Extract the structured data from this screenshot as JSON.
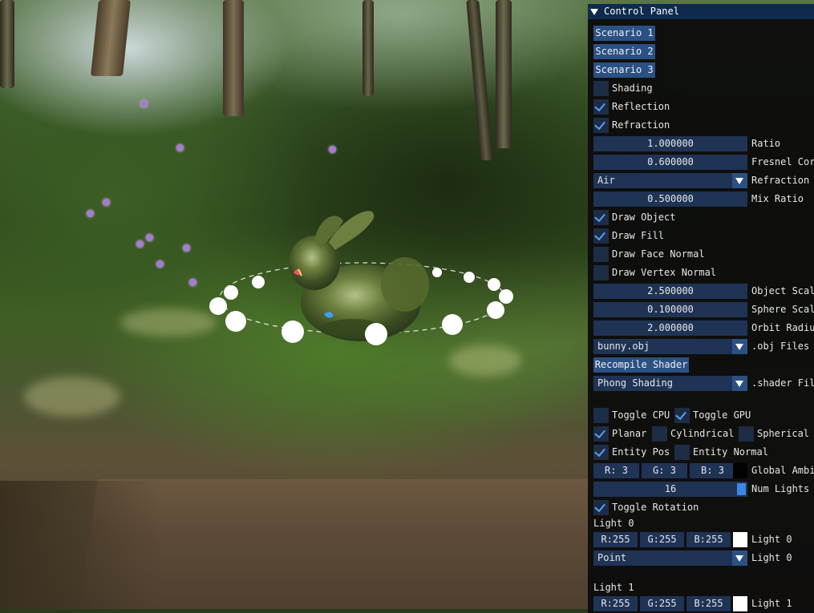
{
  "panel": {
    "title": "Control Panel",
    "scenario_buttons": [
      "Scenario 1",
      "Scenario 2",
      "Scenario 3"
    ],
    "checks_top": [
      {
        "label": "Shading",
        "checked": false
      },
      {
        "label": "Reflection",
        "checked": true
      },
      {
        "label": "Refraction",
        "checked": true
      }
    ],
    "ratio": {
      "value": "1.000000",
      "label": "Ratio"
    },
    "fresnel": {
      "value": "0.600000",
      "label": "Fresnel Cor"
    },
    "refraction_combo": {
      "value": "Air",
      "label": "Refraction"
    },
    "mix_ratio": {
      "value": "0.500000",
      "label": "Mix Ratio"
    },
    "draw_checks": [
      {
        "label": "Draw Object",
        "checked": true
      },
      {
        "label": "Draw Fill",
        "checked": true
      },
      {
        "label": "Draw Face Normal",
        "checked": false
      },
      {
        "label": "Draw Vertex Normal",
        "checked": false
      }
    ],
    "object_scale": {
      "value": "2.500000",
      "label": "Object Scal"
    },
    "sphere_scale": {
      "value": "0.100000",
      "label": "Sphere Scal"
    },
    "orbit_radius": {
      "value": "2.000000",
      "label": "Orbit Radiu"
    },
    "obj_file": {
      "value": "bunny.obj",
      "label": ".obj Files"
    },
    "recompile_label": "Recompile Shader",
    "shader_file": {
      "value": "Phong Shading",
      "label": ".shader Fil"
    },
    "toggle_cpu": {
      "label": "Toggle CPU",
      "checked": false
    },
    "toggle_gpu": {
      "label": "Toggle GPU",
      "checked": true
    },
    "planar": {
      "label": "Planar",
      "checked": true
    },
    "cylindrical": {
      "label": "Cylindrical",
      "checked": false
    },
    "spherical": {
      "label": "Spherical",
      "checked": false
    },
    "entity_pos": {
      "label": "Entity Pos",
      "checked": true
    },
    "entity_normal": {
      "label": "Entity Normal",
      "checked": false
    },
    "global_ambient": {
      "r": "R:  3",
      "g": "G:  3",
      "b": "B:  3",
      "label": "Global Ambi",
      "color": "#030303"
    },
    "num_lights": {
      "value": "16",
      "label": "Num Lights",
      "level": 1.0
    },
    "toggle_rotation": {
      "label": "Toggle Rotation",
      "checked": true
    },
    "lights": [
      {
        "header": "Light 0",
        "r": "R:255",
        "g": "G:255",
        "b": "B:255",
        "color_label": "Light 0",
        "color": "#ffffff",
        "type": "Point",
        "type_label": "Light 0"
      },
      {
        "header": "Light 1",
        "r": "R:255",
        "g": "G:255",
        "b": "B:255",
        "color_label": "Light 1",
        "color": "#ffffff"
      }
    ]
  },
  "colors": {
    "button": "#2b5184",
    "frame": "#1f3355",
    "check": "#5aa0f0",
    "title_bar": "#0f2a4d"
  }
}
